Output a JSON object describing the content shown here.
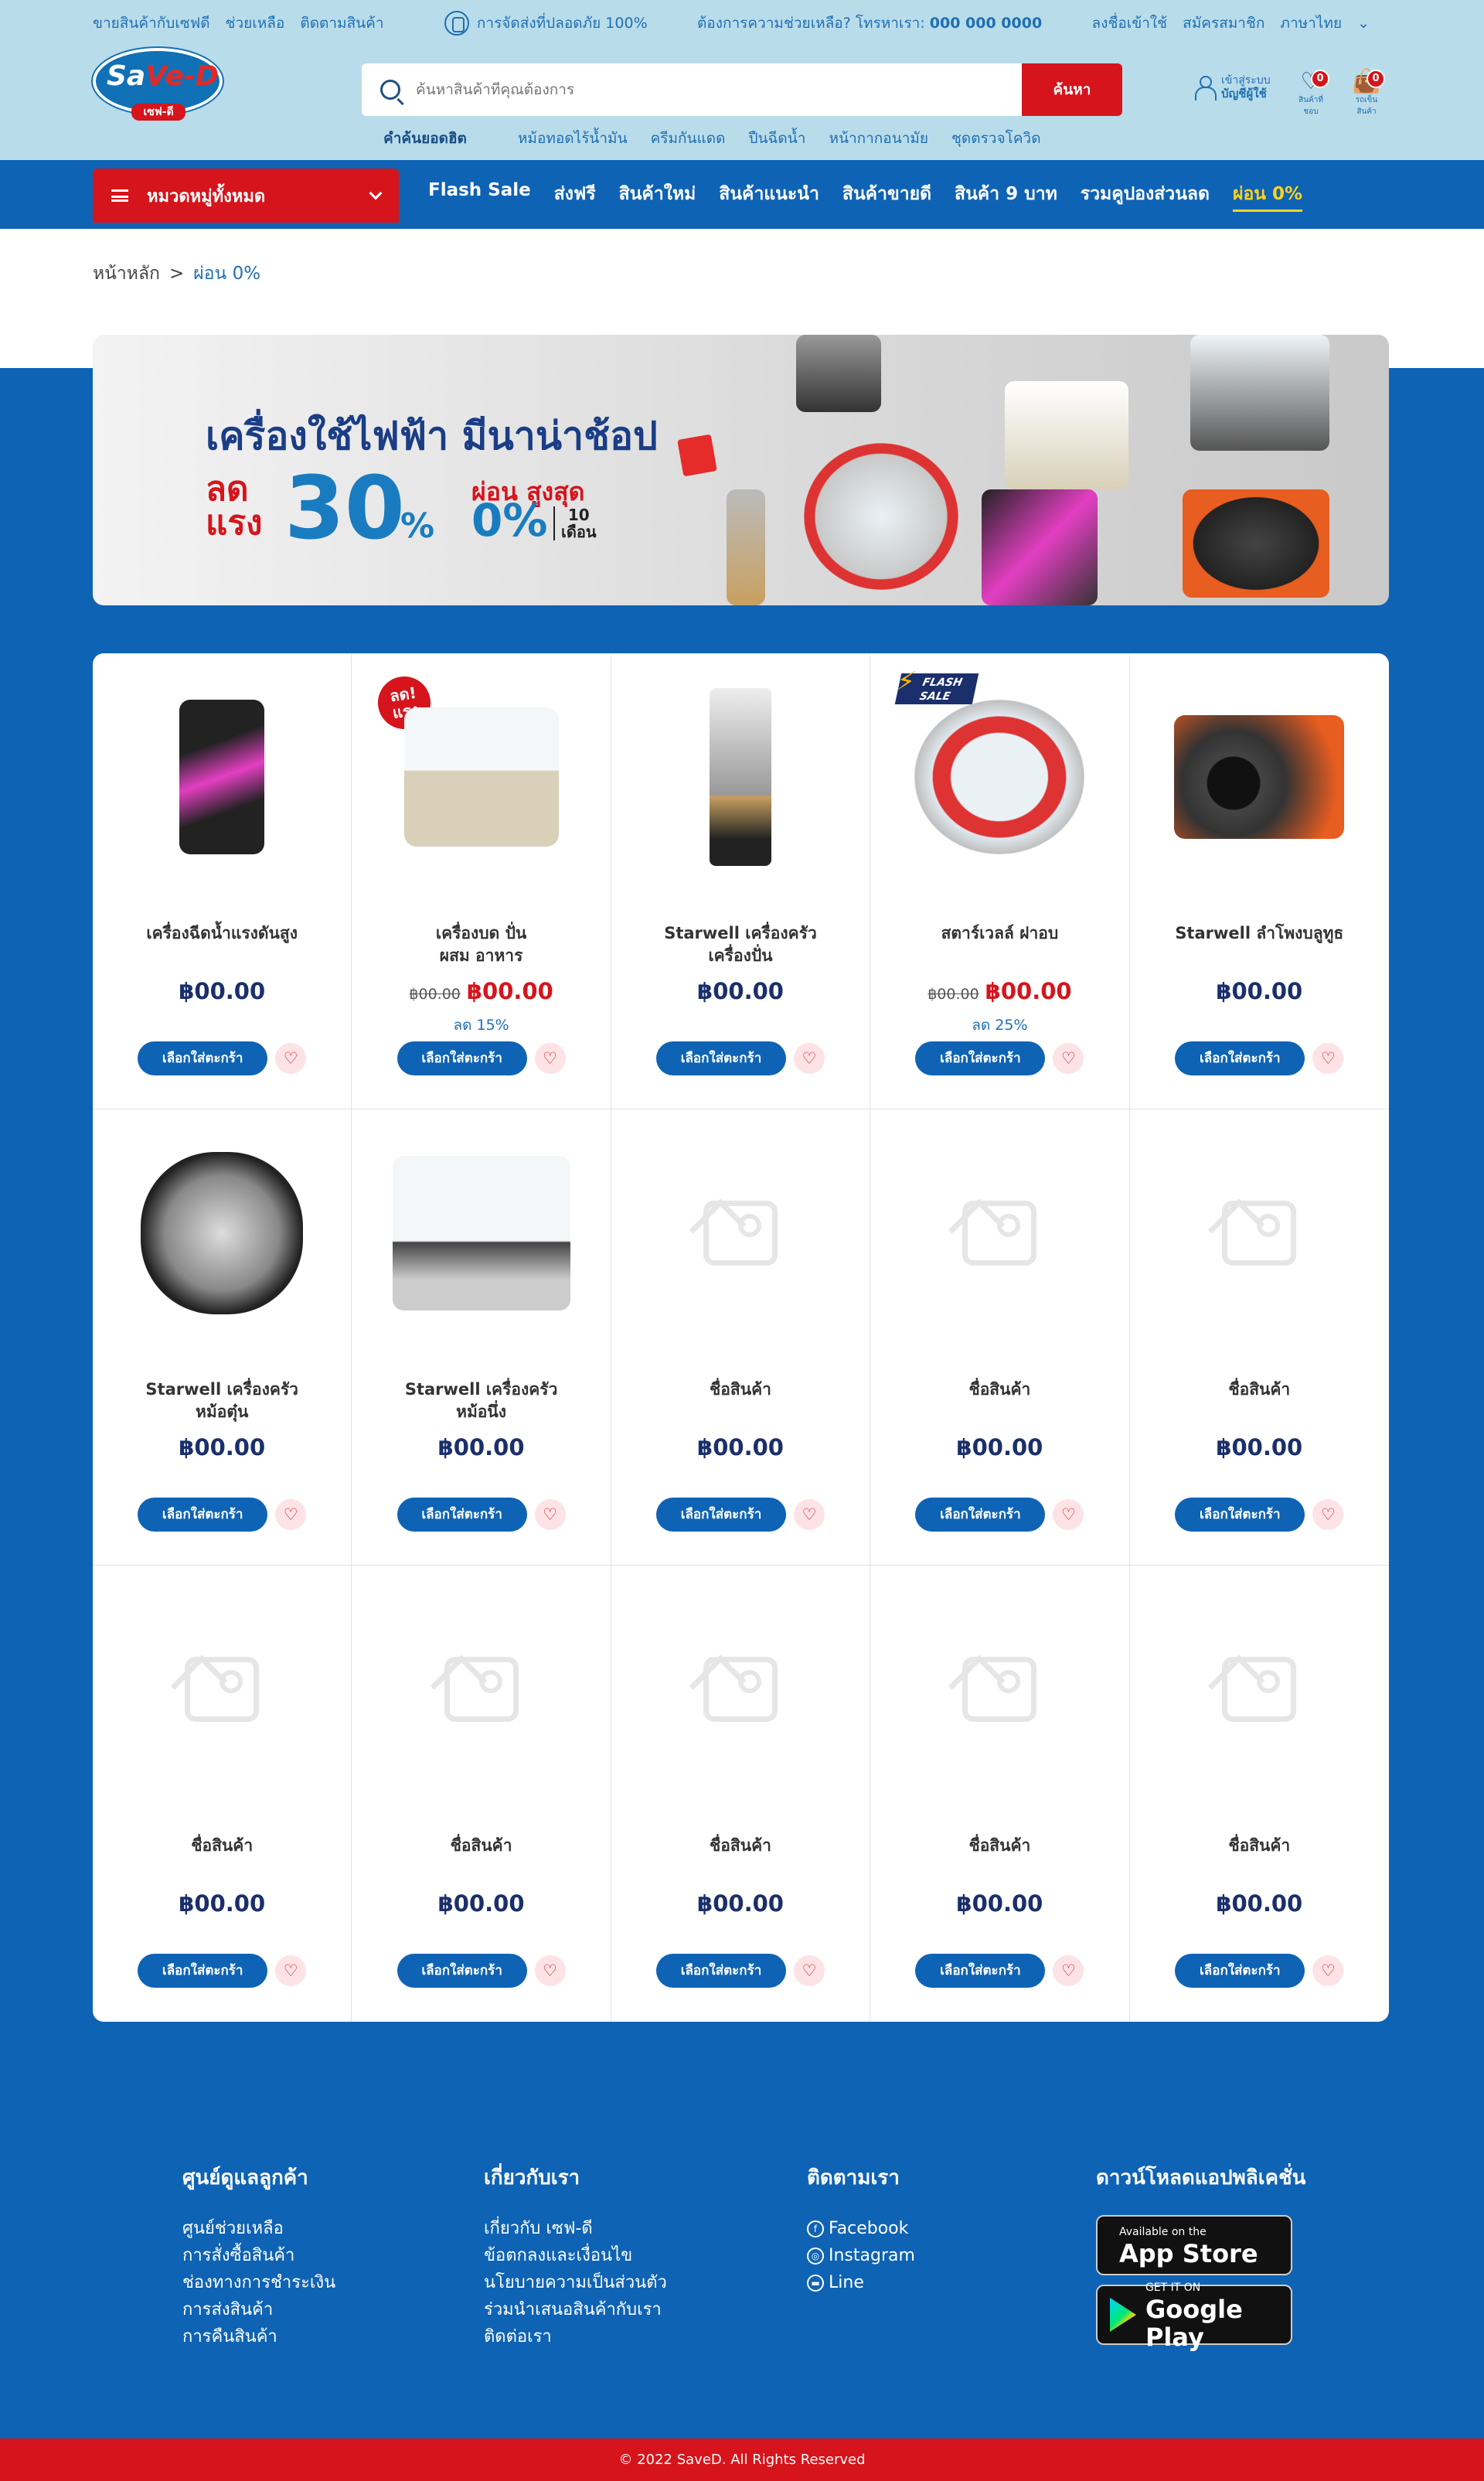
{
  "topbar": {
    "left_links": [
      "ขายสินค้ากับเซฟดี",
      "ช่วยเหลือ",
      "ติดตามสินค้า"
    ],
    "safe_text": "การจัดส่งที่ปลอดภัย 100%",
    "help_text": "ต้องการความช่วยเหลือ? โทรหาเรา:",
    "phone": "000 000 0000",
    "right_links": [
      "ลงชื่อเข้าใช้",
      "สมัครสมาชิก"
    ],
    "language": "ภาษาไทย"
  },
  "logo": {
    "main": "Sa",
    "accent": "Ve-D",
    "sub": "เซฟ-ดี"
  },
  "search": {
    "placeholder": "ค้นหาสินค้าที่คุณต้องการ",
    "button": "ค้นหา"
  },
  "hot_search": {
    "label": "คำค้นยอดฮิต",
    "items": [
      "หม้อทอดไร้น้ำมัน",
      "ครีมกันแดด",
      "ปืนฉีดน้ำ",
      "หน้ากากอนามัย",
      "ชุดตรวจโควิด"
    ]
  },
  "account": {
    "line1": "เข้าสู่ระบบ",
    "line2": "บัญชีผู้ใช้"
  },
  "wishlist": {
    "label": "สินค้าที่ชอบ",
    "count": "0"
  },
  "cart": {
    "label": "รถเข็นสินค้า",
    "count": "0"
  },
  "nav": {
    "category_label": "หมวดหมู่ทั้งหมด",
    "items": [
      "Flash Sale",
      "ส่งฟรี",
      "สินค้าใหม่",
      "สินค้าแนะนำ",
      "สินค้าขายดี",
      "สินค้า 9 บาท",
      "รวมคูปองส่วนลด"
    ],
    "active_item": "ผ่อน 0%"
  },
  "breadcrumb": {
    "home": "หน้าหลัก",
    "separator": ">",
    "current": "ผ่อน 0%"
  },
  "banner": {
    "headline": "เครื่องใช้ไฟฟ้า มีนาน่าช้อป",
    "sale_word_1": "ลด",
    "sale_word_2": "แรง",
    "sale_number": "30",
    "sale_pct": "%",
    "installment_label": "ผ่อน สูงสุด",
    "installment_rate": "0%",
    "months_num": "10",
    "months_word": "เดือน"
  },
  "products": [
    {
      "name": "เครื่องฉีดน้ำแรงดันสูง",
      "price": "฿00.00",
      "old": "",
      "discount": "",
      "tag": "",
      "img": "washer"
    },
    {
      "name": "เครื่องบด ปั่น\nผสม อาหาร",
      "price": "฿00.00",
      "old": "฿00.00",
      "discount": "ลด 15%",
      "tag": "ลด!\nแรง",
      "img": "processor"
    },
    {
      "name": "Starwell เครื่องครัว\nเครื่องปั่น",
      "price": "฿00.00",
      "old": "",
      "discount": "",
      "tag": "",
      "img": "blender"
    },
    {
      "name": "สตาร์เวลล์ ฝาอบ",
      "price": "฿00.00",
      "old": "฿00.00",
      "discount": "ลด 25%",
      "tag": "FLASH\nSALE",
      "img": "oven"
    },
    {
      "name": "Starwell ลำโพงบลูทูธ",
      "price": "฿00.00",
      "old": "",
      "discount": "",
      "tag": "",
      "img": "speaker"
    },
    {
      "name": "Starwell เครื่องครัว\nหม้อตุ๋น",
      "price": "฿00.00",
      "old": "",
      "discount": "",
      "tag": "",
      "img": "cooker"
    },
    {
      "name": "Starwell เครื่องครัว\nหม้อนึ่ง",
      "price": "฿00.00",
      "old": "",
      "discount": "",
      "tag": "",
      "img": "steamer"
    },
    {
      "name": "ชื่อสินค้า",
      "price": "฿00.00",
      "old": "",
      "discount": "",
      "tag": "",
      "img": "placeholder"
    },
    {
      "name": "ชื่อสินค้า",
      "price": "฿00.00",
      "old": "",
      "discount": "",
      "tag": "",
      "img": "placeholder"
    },
    {
      "name": "ชื่อสินค้า",
      "price": "฿00.00",
      "old": "",
      "discount": "",
      "tag": "",
      "img": "placeholder"
    },
    {
      "name": "ชื่อสินค้า",
      "price": "฿00.00",
      "old": "",
      "discount": "",
      "tag": "",
      "img": "placeholder"
    },
    {
      "name": "ชื่อสินค้า",
      "price": "฿00.00",
      "old": "",
      "discount": "",
      "tag": "",
      "img": "placeholder"
    },
    {
      "name": "ชื่อสินค้า",
      "price": "฿00.00",
      "old": "",
      "discount": "",
      "tag": "",
      "img": "placeholder"
    },
    {
      "name": "ชื่อสินค้า",
      "price": "฿00.00",
      "old": "",
      "discount": "",
      "tag": "",
      "img": "placeholder"
    },
    {
      "name": "ชื่อสินค้า",
      "price": "฿00.00",
      "old": "",
      "discount": "",
      "tag": "",
      "img": "placeholder"
    }
  ],
  "add_to_cart": "เลือกใส่ตะกร้า",
  "footer": {
    "customer": {
      "title": "ศูนย์ดูแลลูกค้า",
      "links": [
        "ศูนย์ช่วยเหลือ",
        "การสั่งซื้อสินค้า",
        "ช่องทางการชำระเงิน",
        "การส่งสินค้า",
        "การคืนสินค้า"
      ]
    },
    "about": {
      "title": "เกี่ยวกับเรา",
      "links": [
        "เกี่ยวกับ เซฟ-ดี",
        "ข้อตกลงและเงื่อนไข",
        "นโยบายความเป็นส่วนตัว",
        "ร่วมนำเสนอสินค้ากับเรา",
        "ติดต่อเรา"
      ]
    },
    "follow": {
      "title": "ติดตามเรา",
      "links": [
        "Facebook",
        "Instagram",
        "Line"
      ]
    },
    "app": {
      "title": "ดาวน์โหลดแอปพลิเคชั่น",
      "apple_small": "Available on the",
      "apple_big": "App Store",
      "google_small": "GET IT ON",
      "google_big": "Google Play"
    }
  },
  "copyright": "© 2022 SaveD. All Rights Reserved",
  "colors": {
    "brand_blue": "#0e63b5",
    "brand_red": "#d6141c",
    "accent_yellow": "#ffd21f",
    "top_bg": "#b9dcea"
  }
}
